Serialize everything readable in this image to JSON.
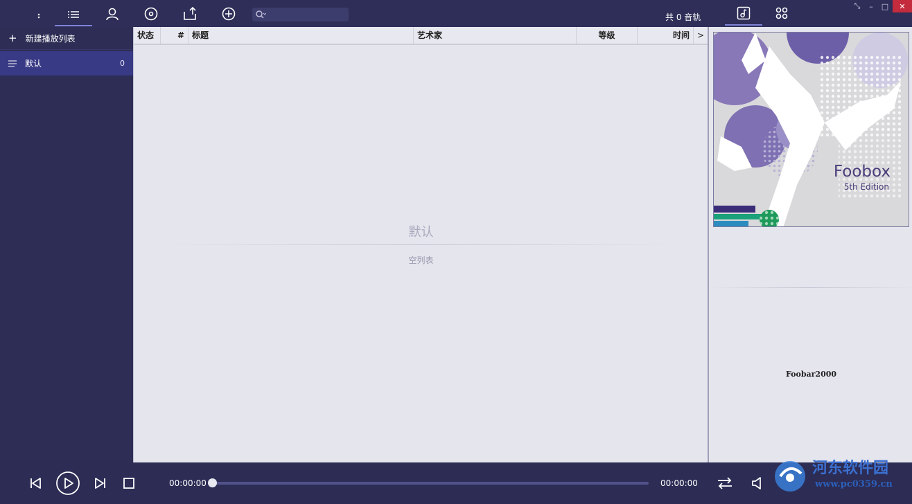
{
  "topbar": {
    "search_placeholder": "",
    "track_count": "共 0 音轨",
    "window": {
      "restore": "⤡",
      "minimize": "–",
      "maximize": "□",
      "close": "✕"
    }
  },
  "sidebar": {
    "new_playlist": "新建播放列表",
    "items": [
      {
        "label": "默认",
        "count": "0"
      }
    ]
  },
  "playlist": {
    "columns": [
      "状态",
      "#",
      "标题",
      "艺术家",
      "等级",
      "时间",
      ">"
    ],
    "empty_title": "默认",
    "empty_sub": "空列表"
  },
  "rightpanel": {
    "cover_title": "Foobox",
    "cover_subtitle": "5th Edition",
    "label": "Foobar2000"
  },
  "bottombar": {
    "time_elapsed": "00:00:00",
    "time_total": "00:00:00",
    "progress": 0
  },
  "watermark": {
    "text": "河东软件园",
    "url": "www.pc0359.cn"
  },
  "colors": {
    "bg": "#2d2d55",
    "accent": "#7e83d6",
    "panel": "#e5e5ee",
    "active_item": "#393a85"
  },
  "icons": [
    "menu-icon",
    "playlist-icon",
    "artist-icon",
    "disc-icon",
    "export-icon",
    "add-icon",
    "search-icon",
    "music-note-icon",
    "grid-icon",
    "prev-icon",
    "play-icon",
    "next-icon",
    "stop-icon",
    "repeat-icon",
    "volume-icon"
  ]
}
